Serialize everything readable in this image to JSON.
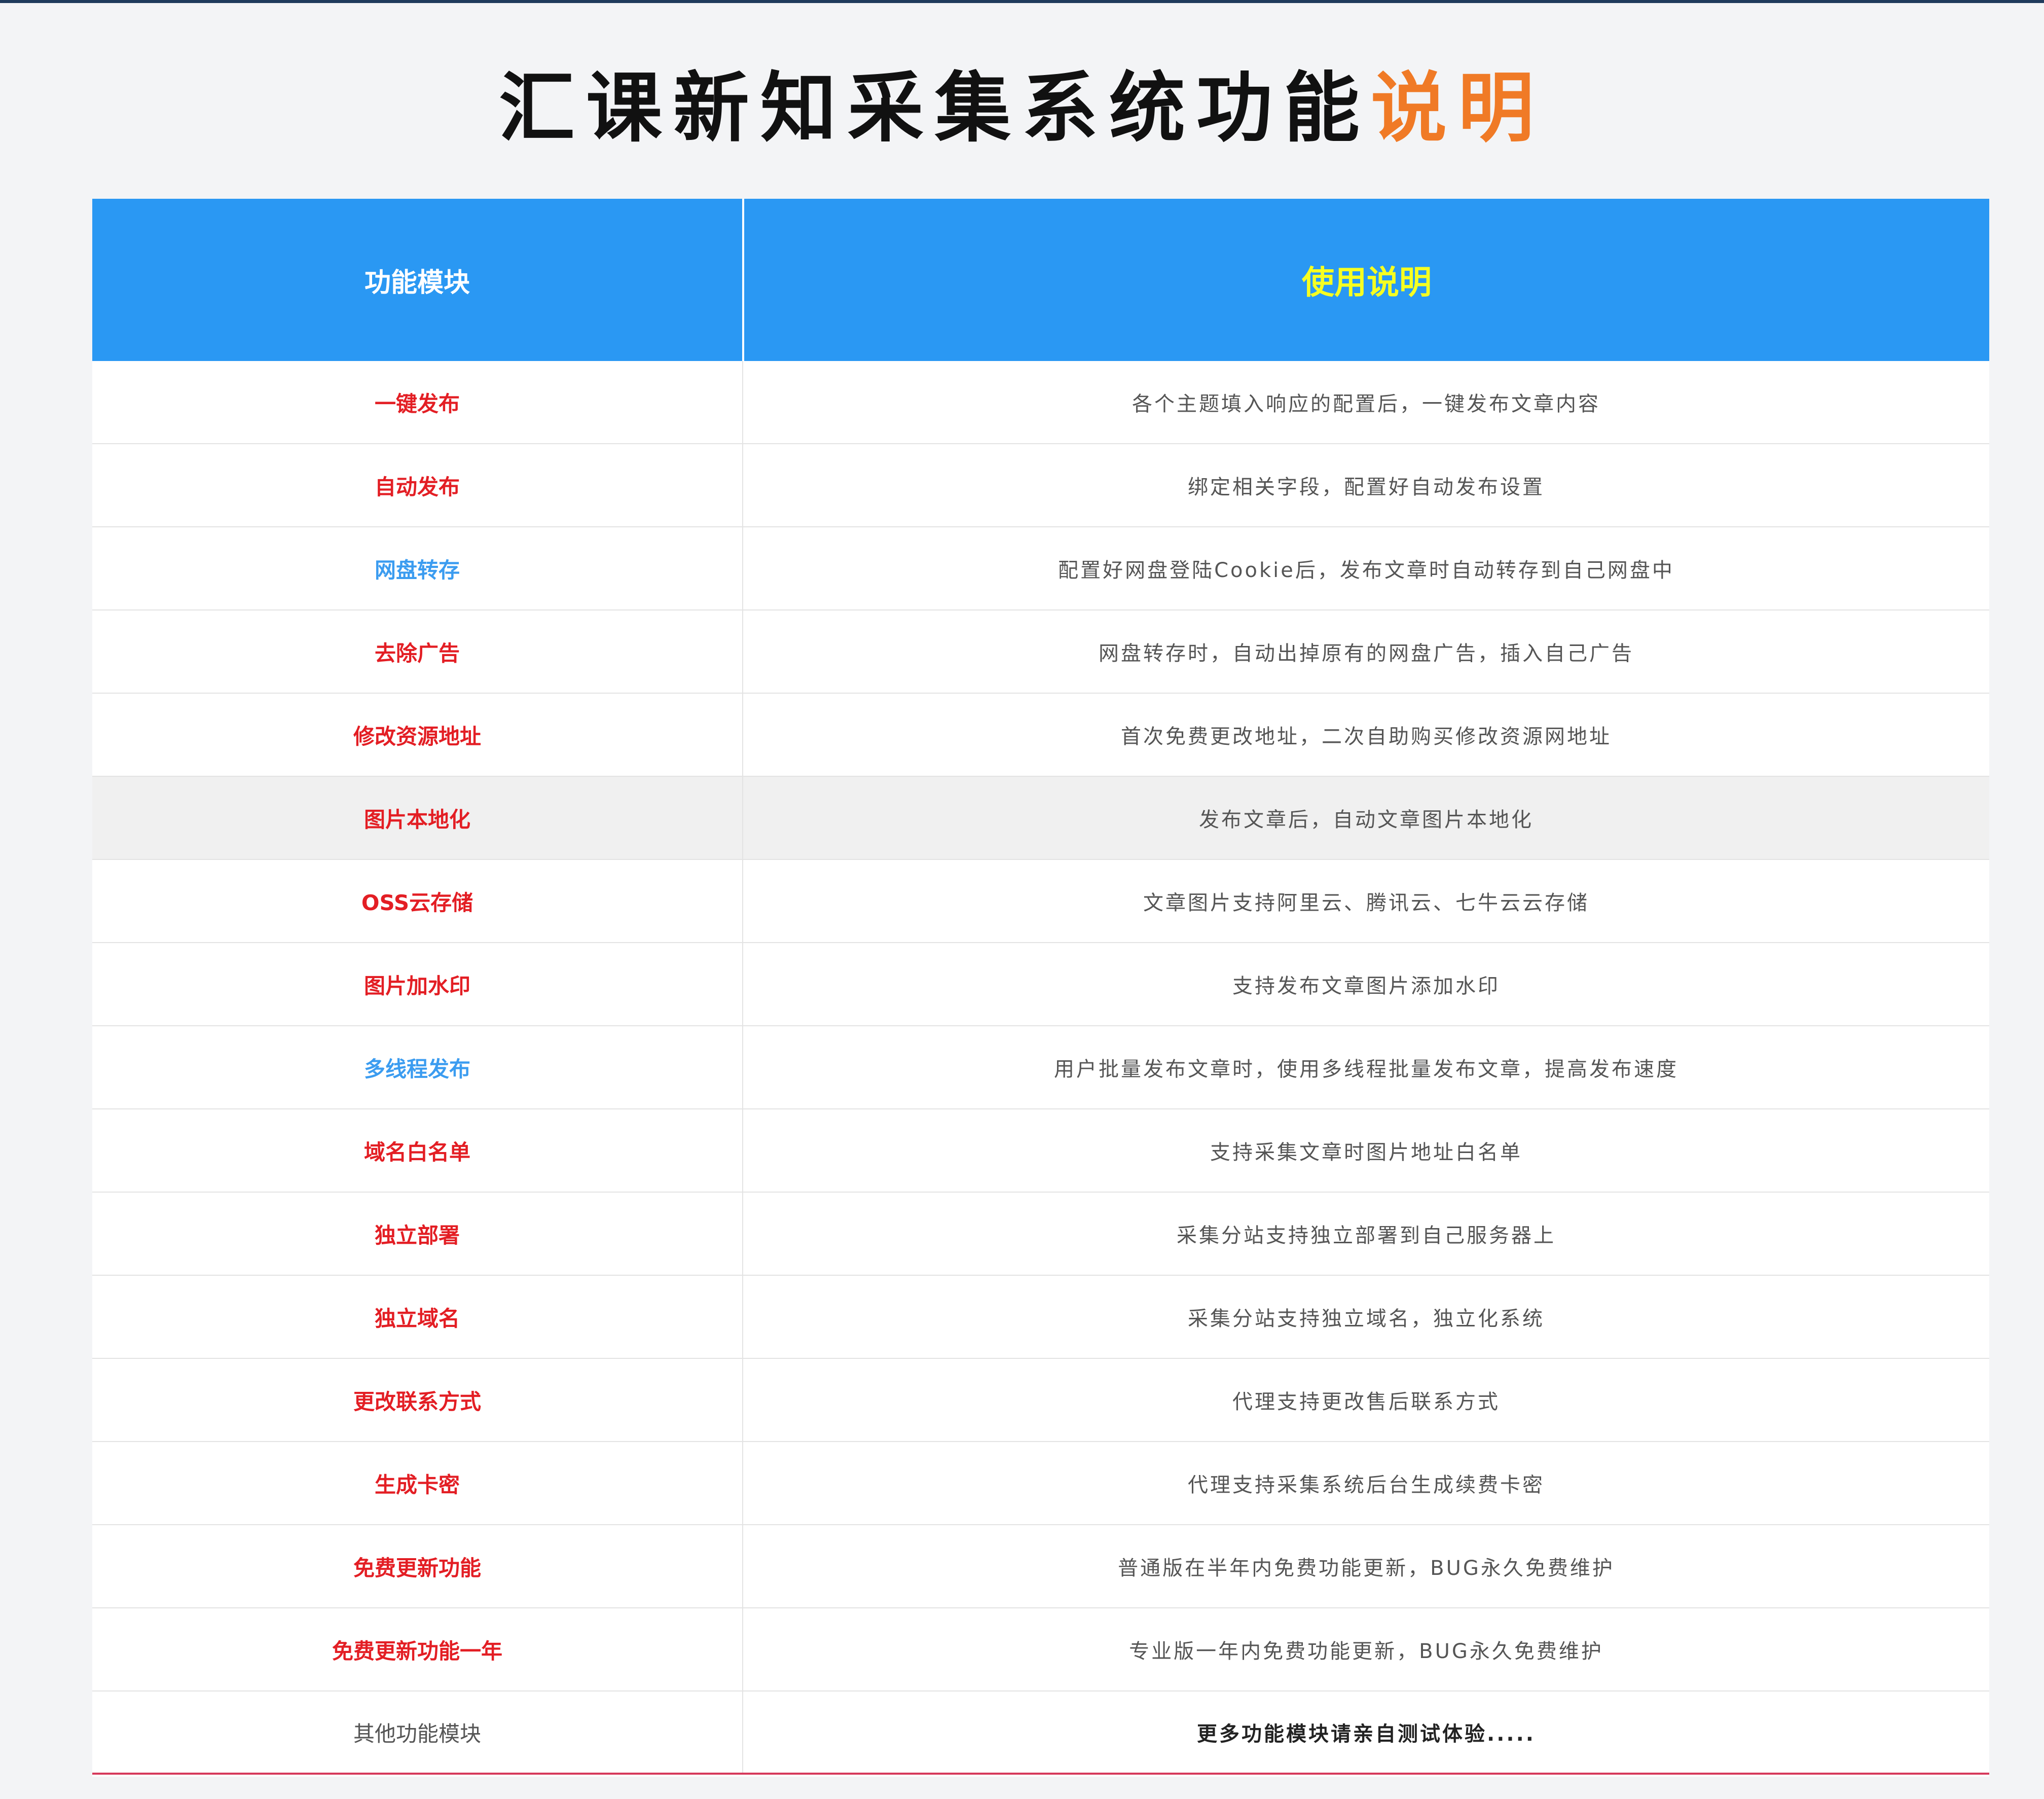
{
  "title": {
    "main": "汇课新知采集系统功能",
    "accent": "说明",
    "accent_color": "#f07a26"
  },
  "table": {
    "header": {
      "col1": "功能模块",
      "col2": "使用说明",
      "bg_color": "#2a98f3",
      "col2_color": "#f6ff21"
    },
    "rows": [
      {
        "module": "一键发布",
        "desc": "各个主题填入响应的配置后，一键发布文章内容",
        "color": "#e31e24"
      },
      {
        "module": "自动发布",
        "desc": "绑定相关字段，配置好自动发布设置",
        "color": "#e31e24"
      },
      {
        "module": "网盘转存",
        "desc": "配置好网盘登陆Cookie后，发布文章时自动转存到自己网盘中",
        "color": "#3b9cf0"
      },
      {
        "module": "去除广告",
        "desc": "网盘转存时，自动出掉原有的网盘广告，插入自己广告",
        "color": "#e31e24"
      },
      {
        "module": "修改资源地址",
        "desc": "首次免费更改地址，二次自助购买修改资源网地址",
        "color": "#e31e24"
      },
      {
        "module": "图片本地化",
        "desc": "发布文章后，自动文章图片本地化",
        "color": "#e31e24"
      },
      {
        "module": "OSS云存储",
        "desc": "文章图片支持阿里云、腾讯云、七牛云云存储",
        "color": "#e31e24"
      },
      {
        "module": "图片加水印",
        "desc": "支持发布文章图片添加水印",
        "color": "#e31e24"
      },
      {
        "module": "多线程发布",
        "desc": "用户批量发布文章时，使用多线程批量发布文章，提高发布速度",
        "color": "#3b9cf0"
      },
      {
        "module": "域名白名单",
        "desc": "支持采集文章时图片地址白名单",
        "color": "#e31e24"
      },
      {
        "module": "独立部署",
        "desc": "采集分站支持独立部署到自己服务器上",
        "color": "#e31e24"
      },
      {
        "module": "独立域名",
        "desc": "采集分站支持独立域名，独立化系统",
        "color": "#e31e24"
      },
      {
        "module": "更改联系方式",
        "desc": "代理支持更改售后联系方式",
        "color": "#e31e24"
      },
      {
        "module": "生成卡密",
        "desc": "代理支持采集系统后台生成续费卡密",
        "color": "#e31e24"
      },
      {
        "module": "免费更新功能",
        "desc": "普通版在半年内免费功能更新，BUG永久免费维护",
        "color": "#e31e24"
      },
      {
        "module": "免费更新功能一年",
        "desc": "专业版一年内免费功能更新，BUG永久免费维护",
        "color": "#e31e24"
      },
      {
        "module": "其他功能模块",
        "desc": "更多功能模块请亲自测试体验.....",
        "color": "#555555"
      }
    ]
  }
}
